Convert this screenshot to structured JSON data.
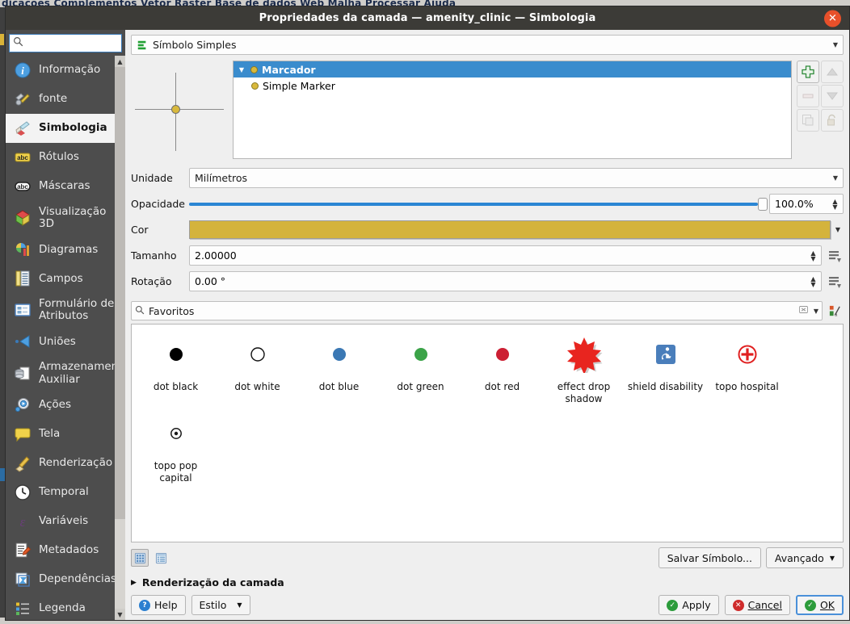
{
  "background": {
    "menubar_text": "dicações   Complementos   Vetor   Raster   Base de dados   Web   Malha   Processar   Ajuda"
  },
  "dialog": {
    "title": "Propriedades da camada — amenity_clinic — Simbologia",
    "close_label": "✕"
  },
  "sidebar": {
    "search_placeholder": "",
    "search_value": "",
    "items": [
      {
        "label": "Informação",
        "icon": "info-icon",
        "active": false
      },
      {
        "label": "fonte",
        "icon": "source-icon",
        "active": false
      },
      {
        "label": "Simbologia",
        "icon": "symbology-brush-icon",
        "active": true
      },
      {
        "label": "Rótulos",
        "icon": "labels-abc-icon",
        "active": false
      },
      {
        "label": "Máscaras",
        "icon": "masks-abc-icon",
        "active": false
      },
      {
        "label": "Visualização 3D",
        "icon": "cube-3d-icon",
        "active": false
      },
      {
        "label": "Diagramas",
        "icon": "diagrams-chart-icon",
        "active": false
      },
      {
        "label": "Campos",
        "icon": "fields-table-icon",
        "active": false
      },
      {
        "label": "Formulário de Atributos",
        "icon": "attribute-form-icon",
        "active": false
      },
      {
        "label": "Uniões",
        "icon": "joins-icon",
        "active": false
      },
      {
        "label": "Armazenamen Auxiliar",
        "icon": "auxiliary-storage-icon",
        "active": false
      },
      {
        "label": "Ações",
        "icon": "actions-gear-icon",
        "active": false
      },
      {
        "label": "Tela",
        "icon": "display-balloon-icon",
        "active": false
      },
      {
        "label": "Renderização",
        "icon": "rendering-brush-icon",
        "active": false
      },
      {
        "label": "Temporal",
        "icon": "clock-icon",
        "active": false
      },
      {
        "label": "Variáveis",
        "icon": "variables-epsilon-icon",
        "active": false
      },
      {
        "label": "Metadados",
        "icon": "metadata-pencil-icon",
        "active": false
      },
      {
        "label": "Dependências",
        "icon": "dependencies-icon",
        "active": false
      },
      {
        "label": "Legenda",
        "icon": "legend-icon",
        "active": false
      }
    ]
  },
  "main": {
    "symbol_type": "Símbolo Simples",
    "tree": {
      "parent": "Marcador",
      "child": "Simple Marker"
    },
    "tree_tools": [
      {
        "name": "add-symbol-layer-button",
        "glyph": "+",
        "enabled": true
      },
      {
        "name": "move-up-button",
        "glyph": "▲",
        "enabled": false
      },
      {
        "name": "remove-symbol-layer-button",
        "glyph": "—",
        "enabled": false
      },
      {
        "name": "move-down-button",
        "glyph": "▼",
        "enabled": false
      },
      {
        "name": "duplicate-symbol-layer-button",
        "glyph": "❐",
        "enabled": false
      },
      {
        "name": "lock-layer-button",
        "glyph": "🔓",
        "enabled": false
      }
    ],
    "properties": {
      "unit_label": "Unidade",
      "unit_value": "Milímetros",
      "opacity_label": "Opacidade",
      "opacity_value": "100.0%",
      "opacity_percent": 100,
      "color_label": "Cor",
      "color_value": "#d4b33c",
      "size_label": "Tamanho",
      "size_value": "2.00000",
      "rotation_label": "Rotação",
      "rotation_value": "0.00 °"
    },
    "favorites": {
      "search_value": "Favoritos",
      "clear_icon": "clear-icon",
      "dropdown_icon": "chevron-down-icon",
      "style_manager_icon": "style-manager-icon"
    },
    "gallery": [
      {
        "label": "dot  black",
        "icon": "dot-black",
        "color": "#000000",
        "style": "filled"
      },
      {
        "label": "dot  white",
        "icon": "dot-white",
        "color": "#ffffff",
        "style": "outline"
      },
      {
        "label": "dot blue",
        "icon": "dot-blue",
        "color": "#3b78b4",
        "style": "filled"
      },
      {
        "label": "dot green",
        "icon": "dot-green",
        "color": "#3ba348",
        "style": "filled"
      },
      {
        "label": "dot red",
        "icon": "dot-red",
        "color": "#cc1f33",
        "style": "filled"
      },
      {
        "label": "effect drop shadow",
        "icon": "effect-drop-shadow",
        "color": "#e8251f",
        "style": "star"
      },
      {
        "label": "shield disability",
        "icon": "shield-disability",
        "color": "#4a7ebb",
        "style": "badge"
      },
      {
        "label": "topo hospital",
        "icon": "topo-hospital",
        "color": "#e02020",
        "style": "cross"
      },
      {
        "label": "topo pop capital",
        "icon": "topo-pop-capital",
        "color": "#1a1a1a",
        "style": "ring-dot"
      }
    ],
    "gallery_toolbar": {
      "icon_view_label": "icon-view-icon",
      "list_view_label": "list-view-icon",
      "save_symbol_label": "Salvar Símbolo...",
      "advanced_label": "Avançado"
    },
    "render_section_label": "Renderização da camada"
  },
  "footer": {
    "help_label": "Help",
    "style_label": "Estilo",
    "apply_label": "Apply",
    "cancel_label": "Cancel",
    "ok_label": "OK"
  }
}
